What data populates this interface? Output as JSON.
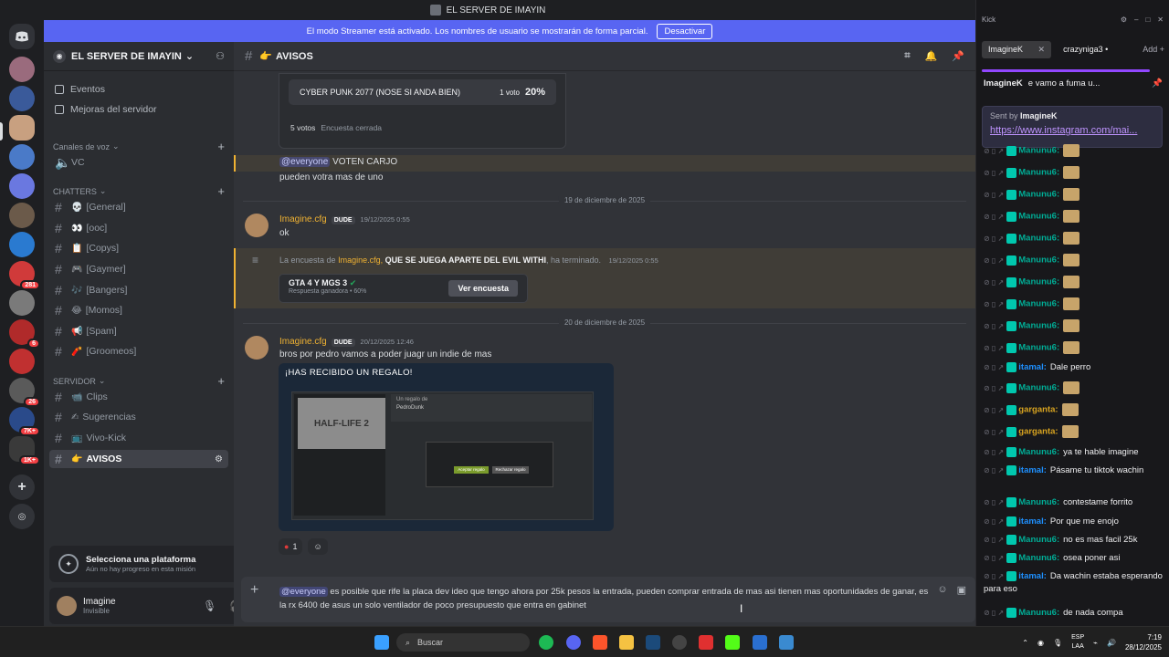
{
  "window": {
    "title": "EL SERVER DE IMAYIN"
  },
  "streamer_banner": {
    "text": "El modo Streamer está activado. Los nombres de usuario se mostrarán de forma parcial.",
    "button": "Desactivar"
  },
  "guild_badges": [
    "281",
    "6",
    "26",
    "7K+",
    "1K+"
  ],
  "server": {
    "name": "EL SERVER DE IMAYIN"
  },
  "nav": {
    "events": "Eventos",
    "boosts": "Mejoras del servidor"
  },
  "categories": {
    "voice": "Canales de voz",
    "chatters": "CHATTERS",
    "servidor": "SERVIDOR"
  },
  "voice_channels": [
    {
      "emoji": "🔈📢",
      "name": "VC"
    }
  ],
  "chatter_channels": [
    {
      "emoji": "💀",
      "name": "[General]"
    },
    {
      "emoji": "👀",
      "name": "[ooc]"
    },
    {
      "emoji": "📋",
      "name": "[Copys]"
    },
    {
      "emoji": "🎮",
      "name": "[Gaymer]"
    },
    {
      "emoji": "🎶",
      "name": "[Bangers]"
    },
    {
      "emoji": "😂",
      "name": "[Momos]"
    },
    {
      "emoji": "📢",
      "name": "[Spam]"
    },
    {
      "emoji": "🧨",
      "name": "[Groomeos]"
    }
  ],
  "server_channels": [
    {
      "emoji": "📹",
      "name": "Clips"
    },
    {
      "emoji": "✍",
      "name": "Sugerencias"
    },
    {
      "emoji": "📺",
      "name": "Vivo-Kick"
    },
    {
      "emoji": "👉",
      "name": "AVISOS"
    }
  ],
  "quest": {
    "title": "Selecciona una plataforma",
    "subtitle": "Aún no hay progreso en esta misión"
  },
  "user": {
    "name": "Imagine",
    "status": "Invisible"
  },
  "channel_header": {
    "name": "AVISOS",
    "emoji": "👉"
  },
  "messages": {
    "poll1": {
      "option": "CYBER PUNK 2077 (NOSE SI ANDA BIEN)",
      "votes": "1 voto",
      "pct": "20%",
      "total": "5 votos",
      "state": "Encuesta cerrada"
    },
    "m1": {
      "mention": "@everyone",
      "text": "VOTEN CARJO"
    },
    "m2": {
      "text": "pueden votra mas de uno"
    },
    "date1": "19 de diciembre de 2025",
    "m3": {
      "author": "Imagine.cfg",
      "tag": "DUDE",
      "time": "19/12/2025 0:55",
      "text": "ok"
    },
    "sys": {
      "pre": "La encuesta de",
      "author": "Imagine.cfg,",
      "title": "QUE SE JUEGA APARTE DEL EVIL WITHI",
      "post": ", ha terminado.",
      "time": "19/12/2025 0:55"
    },
    "poll2": {
      "winner": "GTA 4 Y MGS 3",
      "sub": "Respuesta ganadora • 60%",
      "button": "Ver encuesta"
    },
    "date2": "20 de diciembre de 2025",
    "m4": {
      "author": "Imagine.cfg",
      "tag": "DUDE",
      "time": "20/12/2025 12:46",
      "text": "bros por pedro vamos a poder juagr un indie de mas"
    },
    "gift": {
      "heading": "¡HAS RECIBIDO UN REGALO!",
      "game": "HALF-LIFE 2",
      "from": "Un regalo de",
      "sender": "PedroDunk",
      "accept": "Aceptar regalo",
      "reject": "Rechazar regalo"
    },
    "reaction_count": "1"
  },
  "composer": {
    "mention": "@everyone",
    "text": "es posible que rife la placa dev ideo que tengo ahora por 25k pesos la entrada, pueden comprar entrada de mas asi tienen mas oportunidades de ganar, es la rx 6400 de asus un solo ventilador de poco presupuesto que entra en gabinet"
  },
  "chat_panel": {
    "tabs": [
      "ImagineK",
      "crazyniga3"
    ],
    "add": "Add",
    "title_user": "ImagineK",
    "title_msg": "e vamo a fuma u...",
    "sent_by": "Sent by",
    "sent_user": "ImagineK",
    "link": "https://www.instagram.com/mai...",
    "lines": [
      {
        "user": "Manunu6:",
        "text": "",
        "cls": "n1"
      },
      {
        "user": "Manunu6:",
        "text": "",
        "cls": "n1"
      },
      {
        "user": "Manunu6:",
        "text": "",
        "cls": "n1"
      },
      {
        "user": "Manunu6:",
        "text": "",
        "cls": "n1"
      },
      {
        "user": "Manunu6:",
        "text": "",
        "cls": "n1"
      },
      {
        "user": "Manunu6:",
        "text": "",
        "cls": "n1"
      },
      {
        "user": "Manunu6:",
        "text": "",
        "cls": "n1"
      },
      {
        "user": "Manunu6:",
        "text": "",
        "cls": "n1"
      },
      {
        "user": "Manunu6:",
        "text": "",
        "cls": "n1"
      },
      {
        "user": "Manunu6:",
        "text": "",
        "cls": "n1"
      },
      {
        "user": "itamal:",
        "text": "Dale perro",
        "cls": "n2"
      },
      {
        "user": "Manunu6:",
        "text": "",
        "cls": "n1"
      },
      {
        "user": "garganta:",
        "text": "",
        "cls": "n3"
      },
      {
        "user": "garganta:",
        "text": "",
        "cls": "n3"
      },
      {
        "user": "Manunu6:",
        "text": "ya te hable imagine",
        "cls": "n1"
      },
      {
        "user": "itamal:",
        "text": "Pásame tu tiktok wachin",
        "cls": "n2"
      },
      {
        "user": "Manunu6:",
        "text": "contestame forrito",
        "cls": "n1"
      },
      {
        "user": "itamal:",
        "text": "Por que me enojo",
        "cls": "n2"
      },
      {
        "user": "Manunu6:",
        "text": "no es mas facil 25k",
        "cls": "n1"
      },
      {
        "user": "Manunu6:",
        "text": "osea poner asi",
        "cls": "n1"
      },
      {
        "user": "itamal:",
        "text": "Da wachin estaba esperando para eso",
        "cls": "n2"
      },
      {
        "user": "Manunu6:",
        "text": "de nada compa",
        "cls": "n1"
      }
    ]
  },
  "taskbar": {
    "search": "Buscar",
    "lang1": "ESP",
    "lang2": "LAA",
    "time": "7:19",
    "date": "28/12/2025"
  }
}
